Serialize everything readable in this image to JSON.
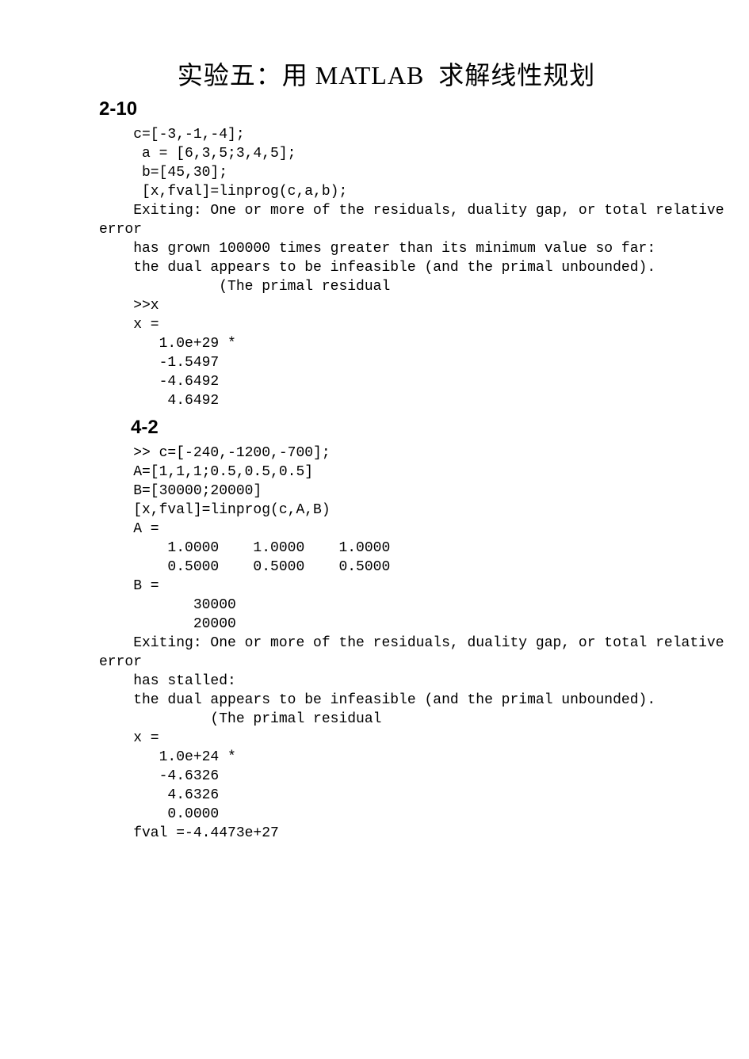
{
  "title_pre": "实验五：用",
  "title_matlab": "MATLAB",
  "title_post": "求解线性规划",
  "sec1": "2-10",
  "block1": "    c=[-3,-1,-4];\n     a = [6,3,5;3,4,5];\n     b=[45,30];\n     [x,fval]=linprog(c,a,b);\n    Exiting: One or more of the residuals, duality gap, or total relative\nerror\n    has grown 100000 times greater than its minimum value so far:\n    the dual appears to be infeasible (and the primal unbounded).\n              (The primal residual\n    >>x\n    x =\n       1.0e+29 *\n       -1.5497\n       -4.6492\n        4.6492",
  "sec2": "4-2",
  "block2": "    >> c=[-240,-1200,-700];\n    A=[1,1,1;0.5,0.5,0.5]\n    B=[30000;20000]\n    [x,fval]=linprog(c,A,B)\n    A =\n        1.0000    1.0000    1.0000\n        0.5000    0.5000    0.5000\n    B =\n           30000\n           20000\n    Exiting: One or more of the residuals, duality gap, or total relative\nerror\n    has stalled:\n    the dual appears to be infeasible (and the primal unbounded).\n             (The primal residual\n    x =\n       1.0e+24 *\n       -4.6326\n        4.6326\n        0.0000\n    fval =-4.4473e+27"
}
